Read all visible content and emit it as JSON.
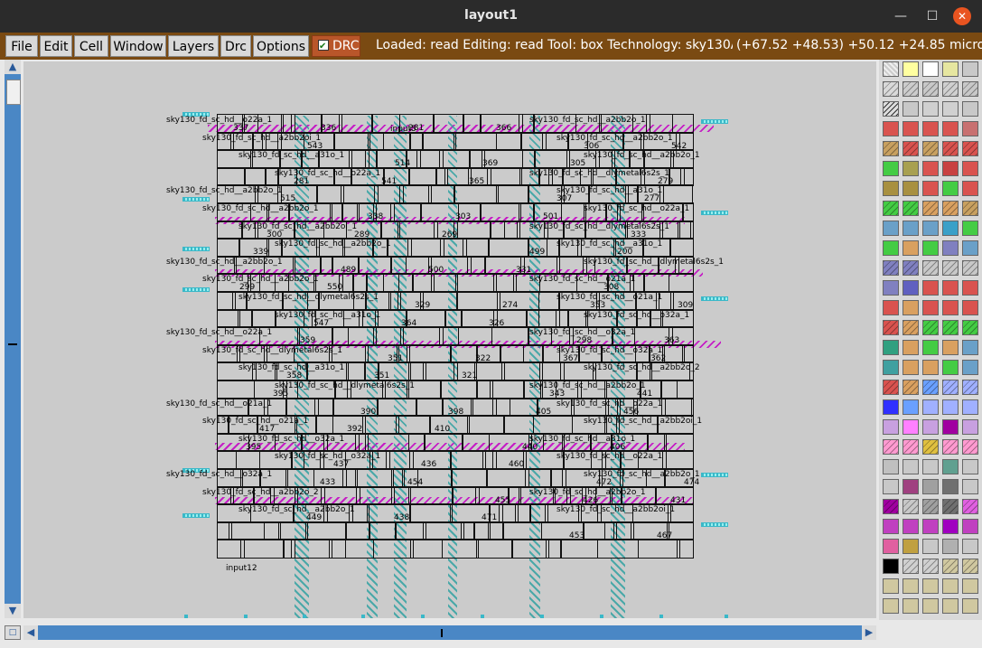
{
  "window": {
    "title": "layout1",
    "min_glyph": "—",
    "max_glyph": "☐",
    "close_glyph": "✕"
  },
  "menu": [
    {
      "label": "File"
    },
    {
      "label": "Edit"
    },
    {
      "label": "Cell"
    },
    {
      "label": "Window"
    },
    {
      "label": "Layers"
    },
    {
      "label": "Drc"
    },
    {
      "label": "Options"
    }
  ],
  "drc": {
    "label": "DRC",
    "checked": true
  },
  "status": {
    "text": "Loaded: read  Editing: read  Tool: box   Technology: sky130A",
    "coords": "(+67.52 +48.53) +50.12 +24.85 microns"
  },
  "scroll": {
    "up": "▲",
    "down": "▼",
    "left": "◀",
    "right": "▶",
    "corner": "□"
  },
  "layout_labels": {
    "rows": [
      "sky130_fd_sc_hd__o22a_1",
      "sky130_fd_sc_hd__a2bb2oi_1",
      "sky130_fd_sc_hd__a31o_1",
      "sky130_fd_sc_hd__o22a_1",
      "sky130_fd_sc_hd__a2bb2o_1",
      "sky130_fd_sc_hd__a2bb2o_1",
      "sky130_fd_sc_hd__a2bb2oi_1",
      "sky130_fd_sc_hd__a2bb2o_1",
      "sky130_fd_sc_hd__a2bb2o_1",
      "sky130_fd_sc_hd__a2bb2o_1",
      "sky130_fd_sc_hd__dlymetal6s2s_1",
      "sky130_fd_sc_hd__a31o_1",
      "sky130_fd_sc_hd__o22a_1",
      "sky130_fd_sc_hd__dlymetal6s2s_1",
      "sky130_fd_sc_hd__a31o_1",
      "sky130_fd_sc_hd__dlymetal6s2s_1",
      "sky130_fd_sc_hd__o21a_1",
      "sky130_fd_sc_hd__o21a_1",
      "sky130_fd_sc_hd__o32a_1",
      "sky130_fd_sc_hd__o32a_1",
      "sky130_fd_sc_hd__o32a_1",
      "sky130_fd_sc_hd__a2bb2o_2",
      "sky130_fd_sc_hd__a2bb2o_1"
    ],
    "numbers": [
      "337",
      "336",
      "281",
      "366",
      "306",
      "542",
      "543",
      "514",
      "369",
      "305",
      "279",
      "281",
      "541",
      "365",
      "307",
      "277",
      "515",
      "338",
      "303",
      "501",
      "333",
      "300",
      "289",
      "269",
      "499",
      "200",
      "339",
      "489",
      "500",
      "331",
      "308",
      "299",
      "550",
      "329",
      "274",
      "353",
      "309",
      "547",
      "364",
      "326",
      "298",
      "363",
      "359",
      "351",
      "322",
      "367",
      "362",
      "358",
      "351",
      "321",
      "343",
      "441",
      "395",
      "390",
      "398",
      "405",
      "456",
      "417",
      "392",
      "410",
      "440",
      "406",
      "395",
      "437",
      "436",
      "460",
      "472",
      "474",
      "433",
      "454",
      "455",
      "426",
      "431",
      "449",
      "438",
      "471",
      "453",
      "467"
    ],
    "inputs": [
      "input5",
      "input12"
    ]
  },
  "colors": {
    "menubar": "#7a4a12",
    "drc": "#b9562a",
    "scroll": "#4a87c5",
    "canvas": "#cbcbcb"
  }
}
